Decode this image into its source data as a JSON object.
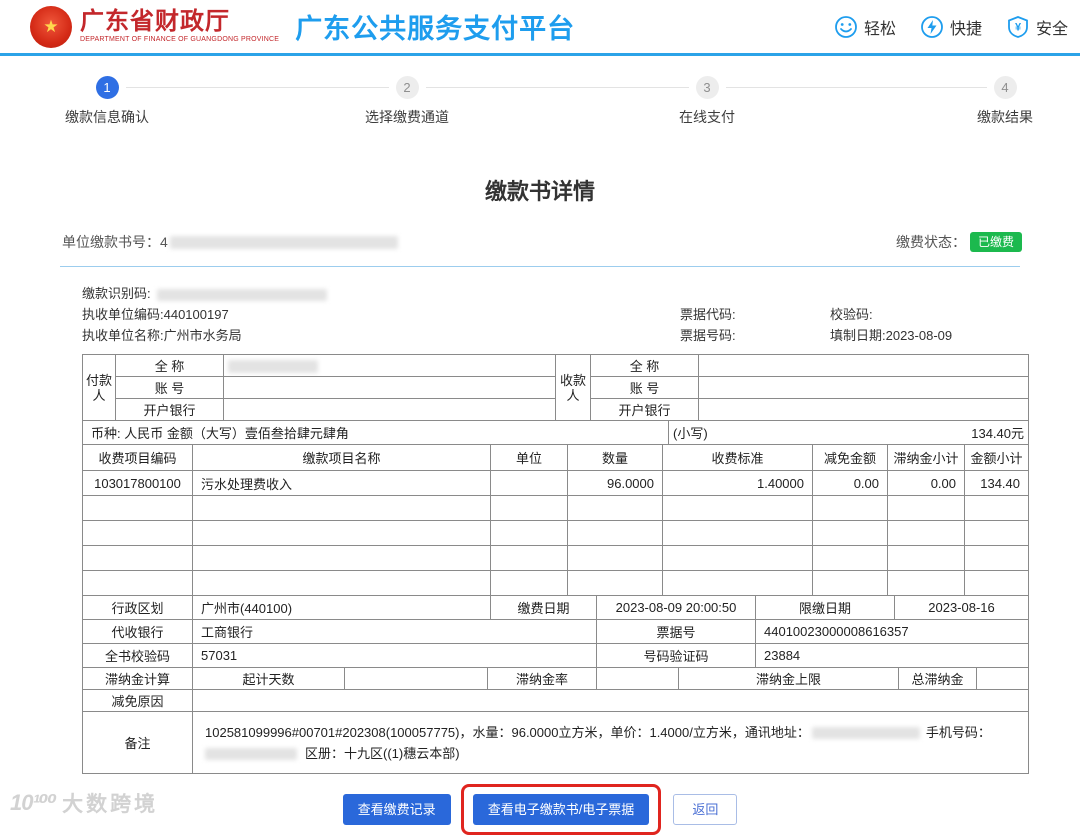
{
  "header": {
    "org_name": "广东省财政厅",
    "org_name_en": "DEPARTMENT OF FINANCE OF GUANGDONG PROVINCE",
    "platform_title": "广东公共服务支付平台",
    "features": [
      {
        "icon": "smiley-icon",
        "label": "轻松"
      },
      {
        "icon": "lightning-icon",
        "label": "快捷"
      },
      {
        "icon": "shield-yuan-icon",
        "label": "安全"
      }
    ]
  },
  "steps": [
    {
      "num": "1",
      "label": "缴款信息确认"
    },
    {
      "num": "2",
      "label": "选择缴费通道"
    },
    {
      "num": "3",
      "label": "在线支付"
    },
    {
      "num": "4",
      "label": "缴款结果"
    }
  ],
  "page": {
    "title": "缴款书详情",
    "doc_no_label": "单位缴款书号：",
    "doc_no_visible": "4",
    "status_label": "缴费状态：",
    "status_value": "已缴费"
  },
  "doc_info": {
    "payment_id_label": "缴款识别码:",
    "unit_code": "执收单位编码:440100197",
    "unit_name": "执收单位名称:广州市水务局",
    "bill_code_label": "票据代码:",
    "check_code_label": "校验码:",
    "bill_no_label": "票据号码:",
    "fill_date": "填制日期:2023-08-09"
  },
  "bill": {
    "payer_label": "付款人",
    "payee_label": "收款人",
    "field_fullname": "全 称",
    "field_account": "账 号",
    "field_bank": "开户银行",
    "currency_line": "币种: 人民币 金额（大写）壹佰叁拾肆元肆角",
    "lowercase_label": "(小写)",
    "amount_small": "134.40元",
    "items_header": [
      "收费项目编码",
      "缴款项目名称",
      "单位",
      "数量",
      "收费标准",
      "减免金额",
      "滞纳金小计",
      "金额小计"
    ],
    "items": [
      [
        "103017800100",
        "污水处理费收入",
        "",
        "96.0000",
        "1.40000",
        "0.00",
        "0.00",
        "134.40"
      ]
    ],
    "region_label": "行政区划",
    "region_value": "广州市(440100)",
    "pay_date_label": "缴费日期",
    "pay_date_value": "2023-08-09 20:00:50",
    "deadline_label": "限缴日期",
    "deadline_value": "2023-08-16",
    "agent_bank_label": "代收银行",
    "agent_bank_value": "工商银行",
    "bill_no_label": "票据号",
    "bill_no_value": "44010023000008616357",
    "doc_check_label": "全书校验码",
    "doc_check_value": "57031",
    "verify_label": "号码验证码",
    "verify_value": "23884",
    "late_fee_calc_label": "滞纳金计算",
    "late_days_label": "起计天数",
    "late_rate_label": "滞纳金率",
    "late_cap_label": "滞纳金上限",
    "late_total_label": "总滞纳金",
    "waiver_label": "减免原因",
    "remark_label": "备注",
    "remark_part1": "102581099996#00701#202308(100057775)，水量：96.0000立方米，单价：1.4000/立方米，通讯地址：",
    "remark_part2": "手机号码：",
    "remark_part3": "区册：十九区((1)穗云本部)"
  },
  "actions": {
    "view_records": "查看缴费记录",
    "view_ebill": "查看电子缴款书/电子票据",
    "back": "返回"
  },
  "watermark": {
    "logo": "10¹⁰⁰",
    "text": "大数跨境"
  },
  "colors": {
    "accent_blue": "#1e9dee",
    "header_line_blue": "#2ba3e8",
    "step_active_blue": "#2f6fe4",
    "status_green": "#1cb94e",
    "button_blue": "#2a68da",
    "highlight_red": "#e0251f"
  }
}
